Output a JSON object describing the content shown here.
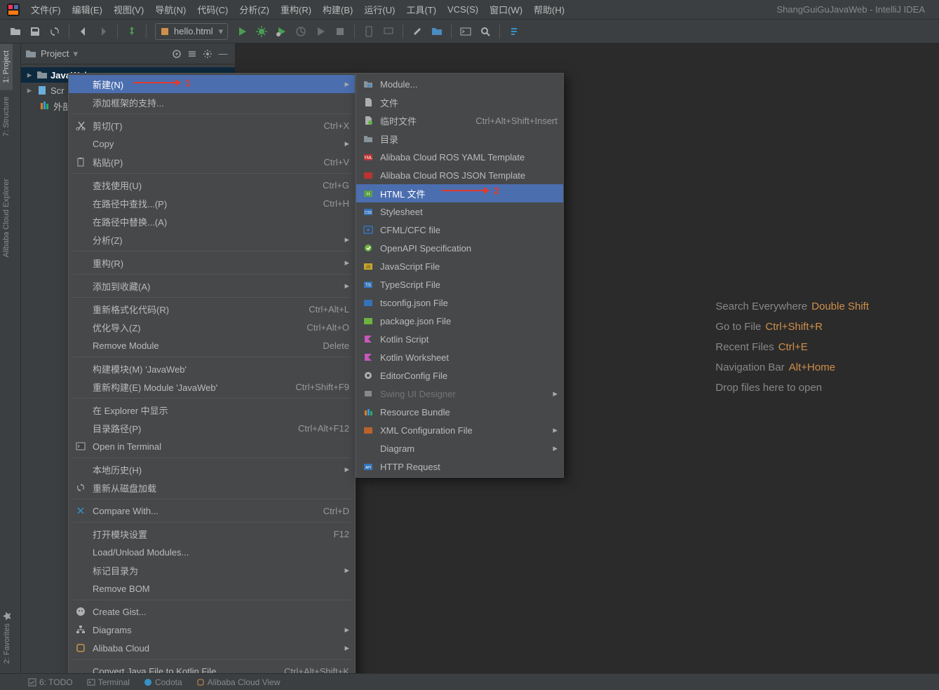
{
  "window_title": "ShangGuiGuJavaWeb - IntelliJ IDEA",
  "menu": {
    "file": "文件(F)",
    "edit": "编辑(E)",
    "view": "视图(V)",
    "navigate": "导航(N)",
    "code": "代码(C)",
    "analyze": "分析(Z)",
    "refactor": "重构(R)",
    "build": "构建(B)",
    "run": "运行(U)",
    "tools": "工具(T)",
    "vcs": "VCS(S)",
    "window": "窗口(W)",
    "help": "帮助(H)"
  },
  "run_config": {
    "name": "hello.html"
  },
  "gutter": {
    "project": "1: Project",
    "structure": "7: Structure",
    "alibaba": "Alibaba Cloud Explorer",
    "favorites": "2: Favorites"
  },
  "project_header": "Project",
  "tree": {
    "root": "JavaWeb",
    "root_hint": "",
    "scratches": "Scratches and Consoles",
    "scratches_vis": "Scr",
    "ext_libs": "外部"
  },
  "welcome": {
    "search": {
      "label": "Search Everywhere",
      "shortcut": "Double Shift"
    },
    "goto": {
      "label": "Go to File",
      "shortcut": "Ctrl+Shift+R"
    },
    "recent": {
      "label": "Recent Files",
      "shortcut": "Ctrl+E"
    },
    "nav": {
      "label": "Navigation Bar",
      "shortcut": "Alt+Home"
    },
    "drop": {
      "label": "Drop files here to open"
    }
  },
  "ctx1": [
    {
      "t": "新建(N)",
      "sc": "",
      "sub": true,
      "sel": true,
      "anno": "1"
    },
    {
      "t": "添加框架的支持..."
    },
    {
      "sep": true
    },
    {
      "icon": "cut",
      "t": "剪切(T)",
      "sc": "Ctrl+X"
    },
    {
      "t": "Copy",
      "sub": true
    },
    {
      "icon": "paste",
      "t": "粘贴(P)",
      "sc": "Ctrl+V"
    },
    {
      "sep": true
    },
    {
      "t": "查找使用(U)",
      "sc": "Ctrl+G"
    },
    {
      "t": "在路径中查找...(P)",
      "sc": "Ctrl+H"
    },
    {
      "t": "在路径中替换...(A)"
    },
    {
      "t": "分析(Z)",
      "sub": true
    },
    {
      "sep": true
    },
    {
      "t": "重构(R)",
      "sub": true
    },
    {
      "sep": true
    },
    {
      "t": "添加到收藏(A)",
      "sub": true
    },
    {
      "sep": true
    },
    {
      "t": "重新格式化代码(R)",
      "sc": "Ctrl+Alt+L"
    },
    {
      "t": "优化导入(Z)",
      "sc": "Ctrl+Alt+O"
    },
    {
      "t": "Remove Module",
      "sc": "Delete"
    },
    {
      "sep": true
    },
    {
      "t": "构建模块(M) 'JavaWeb'"
    },
    {
      "t": "重新构建(E) Module 'JavaWeb'",
      "sc": "Ctrl+Shift+F9"
    },
    {
      "sep": true
    },
    {
      "t": "在 Explorer 中显示"
    },
    {
      "t": "目录路径(P)",
      "sc": "Ctrl+Alt+F12"
    },
    {
      "icon": "terminal",
      "t": "Open in Terminal"
    },
    {
      "sep": true
    },
    {
      "t": "本地历史(H)",
      "sub": true
    },
    {
      "icon": "reload",
      "t": "重新从磁盘加载"
    },
    {
      "sep": true
    },
    {
      "icon": "diff",
      "t": "Compare With...",
      "sc": "Ctrl+D"
    },
    {
      "sep": true
    },
    {
      "t": "打开模块设置",
      "sc": "F12"
    },
    {
      "t": "Load/Unload Modules..."
    },
    {
      "t": "标记目录为",
      "sub": true
    },
    {
      "t": "Remove BOM"
    },
    {
      "sep": true
    },
    {
      "icon": "github",
      "t": "Create Gist..."
    },
    {
      "icon": "diagram",
      "t": "Diagrams",
      "sub": true
    },
    {
      "icon": "alibaba",
      "t": "Alibaba Cloud",
      "sub": true
    },
    {
      "sep": true
    },
    {
      "t": "Convert Java File to Kotlin File",
      "sc": "Ctrl+Alt+Shift+K"
    }
  ],
  "ctx2": [
    {
      "icon": "module",
      "t": "Module..."
    },
    {
      "icon": "file",
      "t": "文件"
    },
    {
      "icon": "scratch",
      "t": "临时文件",
      "sc": "Ctrl+Alt+Shift+Insert"
    },
    {
      "icon": "folder",
      "t": "目录"
    },
    {
      "icon": "yaml",
      "t": "Alibaba Cloud ROS YAML Template"
    },
    {
      "icon": "json",
      "t": "Alibaba Cloud ROS JSON Template"
    },
    {
      "icon": "html",
      "t": "HTML 文件",
      "sel": true,
      "anno": "2"
    },
    {
      "icon": "css",
      "t": "Stylesheet"
    },
    {
      "icon": "cfml",
      "t": "CFML/CFC file"
    },
    {
      "icon": "openapi",
      "t": "OpenAPI Specification"
    },
    {
      "icon": "js",
      "t": "JavaScript File"
    },
    {
      "icon": "ts",
      "t": "TypeScript File"
    },
    {
      "icon": "tsconfig",
      "t": "tsconfig.json File"
    },
    {
      "icon": "package",
      "t": "package.json File"
    },
    {
      "icon": "kotlin",
      "t": "Kotlin Script"
    },
    {
      "icon": "kotlin",
      "t": "Kotlin Worksheet"
    },
    {
      "icon": "editorconfig",
      "t": "EditorConfig File"
    },
    {
      "icon": "swing",
      "t": "Swing UI Designer",
      "sub": true,
      "dim": true
    },
    {
      "icon": "bundle",
      "t": "Resource Bundle"
    },
    {
      "icon": "xml",
      "t": "XML Configuration File",
      "sub": true
    },
    {
      "t": "Diagram",
      "sub": true
    },
    {
      "icon": "http",
      "t": "HTTP Request"
    }
  ],
  "status": {
    "todo": "6: TODO",
    "terminal": "Terminal",
    "codota": "Codota",
    "aliview": "Alibaba Cloud View"
  }
}
